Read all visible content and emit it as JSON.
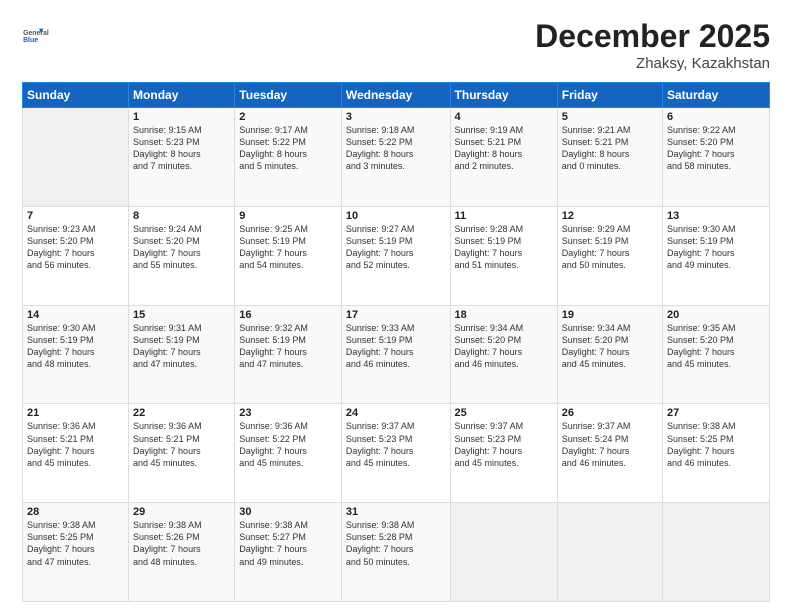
{
  "header": {
    "logo_general": "General",
    "logo_blue": "Blue",
    "month": "December 2025",
    "location": "Zhaksy, Kazakhstan"
  },
  "weekdays": [
    "Sunday",
    "Monday",
    "Tuesday",
    "Wednesday",
    "Thursday",
    "Friday",
    "Saturday"
  ],
  "weeks": [
    [
      {
        "day": "",
        "info": ""
      },
      {
        "day": "1",
        "info": "Sunrise: 9:15 AM\nSunset: 5:23 PM\nDaylight: 8 hours\nand 7 minutes."
      },
      {
        "day": "2",
        "info": "Sunrise: 9:17 AM\nSunset: 5:22 PM\nDaylight: 8 hours\nand 5 minutes."
      },
      {
        "day": "3",
        "info": "Sunrise: 9:18 AM\nSunset: 5:22 PM\nDaylight: 8 hours\nand 3 minutes."
      },
      {
        "day": "4",
        "info": "Sunrise: 9:19 AM\nSunset: 5:21 PM\nDaylight: 8 hours\nand 2 minutes."
      },
      {
        "day": "5",
        "info": "Sunrise: 9:21 AM\nSunset: 5:21 PM\nDaylight: 8 hours\nand 0 minutes."
      },
      {
        "day": "6",
        "info": "Sunrise: 9:22 AM\nSunset: 5:20 PM\nDaylight: 7 hours\nand 58 minutes."
      }
    ],
    [
      {
        "day": "7",
        "info": "Sunrise: 9:23 AM\nSunset: 5:20 PM\nDaylight: 7 hours\nand 56 minutes."
      },
      {
        "day": "8",
        "info": "Sunrise: 9:24 AM\nSunset: 5:20 PM\nDaylight: 7 hours\nand 55 minutes."
      },
      {
        "day": "9",
        "info": "Sunrise: 9:25 AM\nSunset: 5:19 PM\nDaylight: 7 hours\nand 54 minutes."
      },
      {
        "day": "10",
        "info": "Sunrise: 9:27 AM\nSunset: 5:19 PM\nDaylight: 7 hours\nand 52 minutes."
      },
      {
        "day": "11",
        "info": "Sunrise: 9:28 AM\nSunset: 5:19 PM\nDaylight: 7 hours\nand 51 minutes."
      },
      {
        "day": "12",
        "info": "Sunrise: 9:29 AM\nSunset: 5:19 PM\nDaylight: 7 hours\nand 50 minutes."
      },
      {
        "day": "13",
        "info": "Sunrise: 9:30 AM\nSunset: 5:19 PM\nDaylight: 7 hours\nand 49 minutes."
      }
    ],
    [
      {
        "day": "14",
        "info": "Sunrise: 9:30 AM\nSunset: 5:19 PM\nDaylight: 7 hours\nand 48 minutes."
      },
      {
        "day": "15",
        "info": "Sunrise: 9:31 AM\nSunset: 5:19 PM\nDaylight: 7 hours\nand 47 minutes."
      },
      {
        "day": "16",
        "info": "Sunrise: 9:32 AM\nSunset: 5:19 PM\nDaylight: 7 hours\nand 47 minutes."
      },
      {
        "day": "17",
        "info": "Sunrise: 9:33 AM\nSunset: 5:19 PM\nDaylight: 7 hours\nand 46 minutes."
      },
      {
        "day": "18",
        "info": "Sunrise: 9:34 AM\nSunset: 5:20 PM\nDaylight: 7 hours\nand 46 minutes."
      },
      {
        "day": "19",
        "info": "Sunrise: 9:34 AM\nSunset: 5:20 PM\nDaylight: 7 hours\nand 45 minutes."
      },
      {
        "day": "20",
        "info": "Sunrise: 9:35 AM\nSunset: 5:20 PM\nDaylight: 7 hours\nand 45 minutes."
      }
    ],
    [
      {
        "day": "21",
        "info": "Sunrise: 9:36 AM\nSunset: 5:21 PM\nDaylight: 7 hours\nand 45 minutes."
      },
      {
        "day": "22",
        "info": "Sunrise: 9:36 AM\nSunset: 5:21 PM\nDaylight: 7 hours\nand 45 minutes."
      },
      {
        "day": "23",
        "info": "Sunrise: 9:36 AM\nSunset: 5:22 PM\nDaylight: 7 hours\nand 45 minutes."
      },
      {
        "day": "24",
        "info": "Sunrise: 9:37 AM\nSunset: 5:23 PM\nDaylight: 7 hours\nand 45 minutes."
      },
      {
        "day": "25",
        "info": "Sunrise: 9:37 AM\nSunset: 5:23 PM\nDaylight: 7 hours\nand 45 minutes."
      },
      {
        "day": "26",
        "info": "Sunrise: 9:37 AM\nSunset: 5:24 PM\nDaylight: 7 hours\nand 46 minutes."
      },
      {
        "day": "27",
        "info": "Sunrise: 9:38 AM\nSunset: 5:25 PM\nDaylight: 7 hours\nand 46 minutes."
      }
    ],
    [
      {
        "day": "28",
        "info": "Sunrise: 9:38 AM\nSunset: 5:25 PM\nDaylight: 7 hours\nand 47 minutes."
      },
      {
        "day": "29",
        "info": "Sunrise: 9:38 AM\nSunset: 5:26 PM\nDaylight: 7 hours\nand 48 minutes."
      },
      {
        "day": "30",
        "info": "Sunrise: 9:38 AM\nSunset: 5:27 PM\nDaylight: 7 hours\nand 49 minutes."
      },
      {
        "day": "31",
        "info": "Sunrise: 9:38 AM\nSunset: 5:28 PM\nDaylight: 7 hours\nand 50 minutes."
      },
      {
        "day": "",
        "info": ""
      },
      {
        "day": "",
        "info": ""
      },
      {
        "day": "",
        "info": ""
      }
    ]
  ]
}
